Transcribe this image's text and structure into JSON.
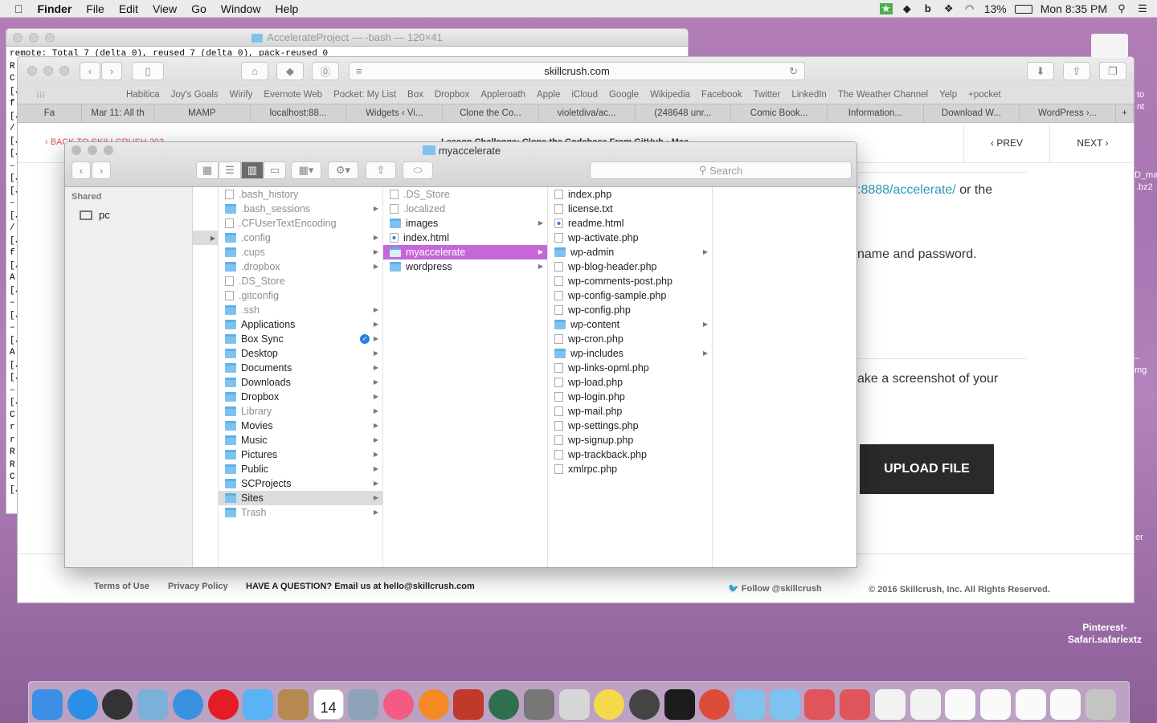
{
  "menubar": {
    "app": "Finder",
    "items": [
      "File",
      "Edit",
      "View",
      "Go",
      "Window",
      "Help"
    ],
    "battery": "13%",
    "clock": "Mon 8:35 PM"
  },
  "terminal": {
    "title": "AccelerateProject — -bash — 120×41",
    "lines": [
      "remote: Total 7 (delta 0), reused 7 (delta 0), pack-reused 0",
      "R",
      "C",
      "[J",
      "f",
      "[J",
      "/",
      "[J",
      "[J",
      "–",
      "[J",
      "[J",
      "–",
      "[J",
      "/",
      "[J",
      "f",
      "[J",
      "A",
      "[J",
      "–",
      "[J",
      "–",
      "[J",
      "A",
      "[J",
      "[J",
      "–",
      "[J",
      "C",
      "r",
      "r",
      "R",
      "R",
      "C",
      "[J"
    ]
  },
  "safari": {
    "url": "skillcrush.com",
    "favorites": [
      "Habitica",
      "Joy's Goals",
      "Wirify",
      "Evernote Web",
      "Pocket: My List",
      "Box",
      "Dropbox",
      "Appleroath",
      "Apple",
      "iCloud",
      "Google",
      "Wikipedia",
      "Facebook",
      "Twitter",
      "LinkedIn",
      "The Weather Channel",
      "Yelp",
      "+pocket"
    ],
    "tabs": [
      "Mar 11: All th",
      "MAMP",
      "localhost:88...",
      "Widgets ‹ Vi...",
      "Clone the Co...",
      "violetdiva/ac...",
      "(248648 unr...",
      "Comic Book...",
      "Information...",
      "Download W...",
      "WordPress ›..."
    ]
  },
  "site": {
    "back": "‹ BACK TO SKILLCRUSH 203",
    "lesson": "Lesson Challenge: Clone the Codebase From GitHub · Mac",
    "prev": "PREV",
    "next": "NEXT",
    "text1_link": ":8888/accelerate/",
    "text1_rest": " or the",
    "text2": "name and password.",
    "text3": "ake a screenshot of your",
    "upload": "UPLOAD FILE",
    "footer": {
      "terms": "Terms of Use",
      "privacy": "Privacy Policy",
      "question": "HAVE A QUESTION? Email us at hello@skillcrush.com",
      "follow": "Follow @skillcrush",
      "copyright": "© 2016 Skillcrush, Inc. All Rights Reserved."
    }
  },
  "finder": {
    "title": "myaccelerate",
    "search_placeholder": "Search",
    "sidebar_heading": "Shared",
    "sidebar_item": "pc",
    "col1": [
      {
        "n": ".bash_history",
        "t": "doc",
        "g": true
      },
      {
        "n": ".bash_sessions",
        "t": "folder",
        "g": true,
        "a": true
      },
      {
        "n": ".CFUserTextEncoding",
        "t": "doc",
        "g": true
      },
      {
        "n": ".config",
        "t": "folder",
        "g": true,
        "a": true
      },
      {
        "n": ".cups",
        "t": "folder",
        "g": true,
        "a": true
      },
      {
        "n": ".dropbox",
        "t": "folder",
        "g": true,
        "a": true
      },
      {
        "n": ".DS_Store",
        "t": "doc",
        "g": true
      },
      {
        "n": ".gitconfig",
        "t": "doc",
        "g": true
      },
      {
        "n": ".ssh",
        "t": "folder",
        "g": true,
        "a": true
      },
      {
        "n": "Applications",
        "t": "folder",
        "a": true
      },
      {
        "n": "Box Sync",
        "t": "folder",
        "a": true,
        "badge": true
      },
      {
        "n": "Desktop",
        "t": "folder",
        "a": true
      },
      {
        "n": "Documents",
        "t": "folder",
        "a": true
      },
      {
        "n": "Downloads",
        "t": "folder",
        "a": true
      },
      {
        "n": "Dropbox",
        "t": "folder",
        "a": true
      },
      {
        "n": "Library",
        "t": "folder",
        "g": true,
        "a": true
      },
      {
        "n": "Movies",
        "t": "folder",
        "a": true
      },
      {
        "n": "Music",
        "t": "folder",
        "a": true
      },
      {
        "n": "Pictures",
        "t": "folder",
        "a": true
      },
      {
        "n": "Public",
        "t": "folder",
        "a": true
      },
      {
        "n": "SCProjects",
        "t": "folder",
        "a": true
      },
      {
        "n": "Sites",
        "t": "folder",
        "a": true,
        "h": true
      },
      {
        "n": "Trash",
        "t": "folder",
        "g": true,
        "a": true
      }
    ],
    "col2": [
      {
        "n": ".DS_Store",
        "t": "doc",
        "g": true
      },
      {
        "n": ".localized",
        "t": "doc",
        "g": true
      },
      {
        "n": "images",
        "t": "folder",
        "a": true
      },
      {
        "n": "index.html",
        "t": "html"
      },
      {
        "n": "myaccelerate",
        "t": "folder",
        "a": true,
        "s": true
      },
      {
        "n": "wordpress",
        "t": "folder",
        "a": true
      }
    ],
    "col3": [
      {
        "n": "index.php",
        "t": "doc"
      },
      {
        "n": "license.txt",
        "t": "doc"
      },
      {
        "n": "readme.html",
        "t": "html"
      },
      {
        "n": "wp-activate.php",
        "t": "doc"
      },
      {
        "n": "wp-admin",
        "t": "folder",
        "a": true
      },
      {
        "n": "wp-blog-header.php",
        "t": "doc"
      },
      {
        "n": "wp-comments-post.php",
        "t": "doc"
      },
      {
        "n": "wp-config-sample.php",
        "t": "doc"
      },
      {
        "n": "wp-config.php",
        "t": "doc"
      },
      {
        "n": "wp-content",
        "t": "folder",
        "a": true
      },
      {
        "n": "wp-cron.php",
        "t": "doc"
      },
      {
        "n": "wp-includes",
        "t": "folder",
        "a": true
      },
      {
        "n": "wp-links-opml.php",
        "t": "doc"
      },
      {
        "n": "wp-load.php",
        "t": "doc"
      },
      {
        "n": "wp-login.php",
        "t": "doc"
      },
      {
        "n": "wp-mail.php",
        "t": "doc"
      },
      {
        "n": "wp-settings.php",
        "t": "doc"
      },
      {
        "n": "wp-signup.php",
        "t": "doc"
      },
      {
        "n": "wp-trackback.php",
        "t": "doc"
      },
      {
        "n": "xmlrpc.php",
        "t": "doc"
      }
    ]
  },
  "desktop": {
    "items": [
      "to",
      "nt",
      "D_ma",
      ".bz2",
      "–",
      "mg",
      "er",
      "Pinterest-Safari.safariextz"
    ]
  },
  "dock": {
    "apps": [
      "finder",
      "app-store",
      "dashboard",
      "preview",
      "safari",
      "opera",
      "messages",
      "contacts",
      "calendar",
      "image-capture",
      "itunes",
      "ibooks",
      "photo-booth",
      "time-machine",
      "system-preferences",
      "preview-2",
      "photos",
      "gitify",
      "terminal",
      "chrome",
      "applications-folder",
      "documents-folder",
      "stack-1",
      "stack-2",
      "stack-3",
      "stack-4",
      "stack-5",
      "stack-6",
      "stack-7",
      "stack-8",
      "trash"
    ],
    "calendar_month": "MAR",
    "calendar_day": "14"
  }
}
